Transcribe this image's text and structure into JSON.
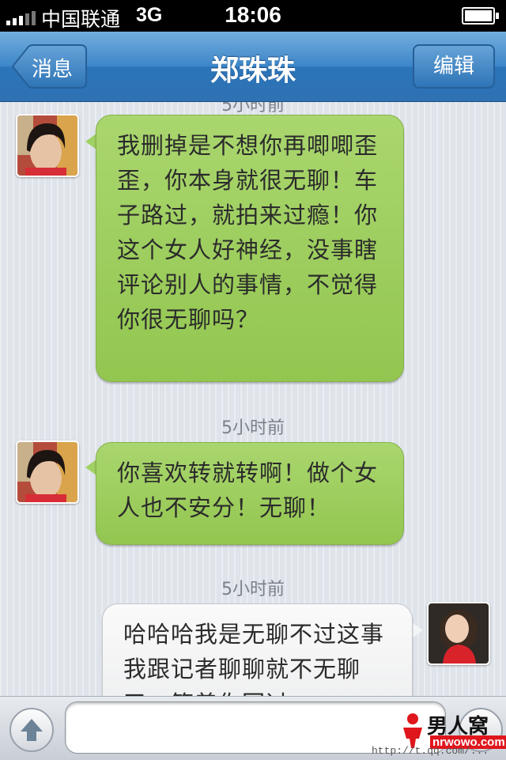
{
  "status_bar": {
    "carrier": "中国联通",
    "network": "3G",
    "time": "18:06",
    "battery_level": 1.0
  },
  "nav": {
    "back_label": "消息",
    "title": "郑珠珠",
    "edit_label": "编辑"
  },
  "messages": [
    {
      "timestamp": "5小时前",
      "side": "left",
      "text": "我删掉是不想你再唧唧歪歪，你本身就很无聊！车子路过，就拍来过瘾！你这个女人好神经，没事瞎评论别人的事情，不觉得你很无聊吗？"
    },
    {
      "timestamp": "5小时前",
      "side": "left",
      "text": "你喜欢转就转啊！做个女人也不安分！无聊！"
    },
    {
      "timestamp": "5小时前",
      "side": "right",
      "text": "哈哈哈我是无聊不过这事我跟记者聊聊就不无聊了，等着你回过"
    }
  ],
  "input": {
    "placeholder": ""
  },
  "watermark": {
    "brand": "男人窝",
    "site": "nrwowo.com",
    "url": "http://t.qq.com/..."
  },
  "colors": {
    "nav_blue": "#3c86c8",
    "bubble_green": "#9dcd5e",
    "bubble_white": "#f2f3f4",
    "background": "#dfe3ea"
  }
}
